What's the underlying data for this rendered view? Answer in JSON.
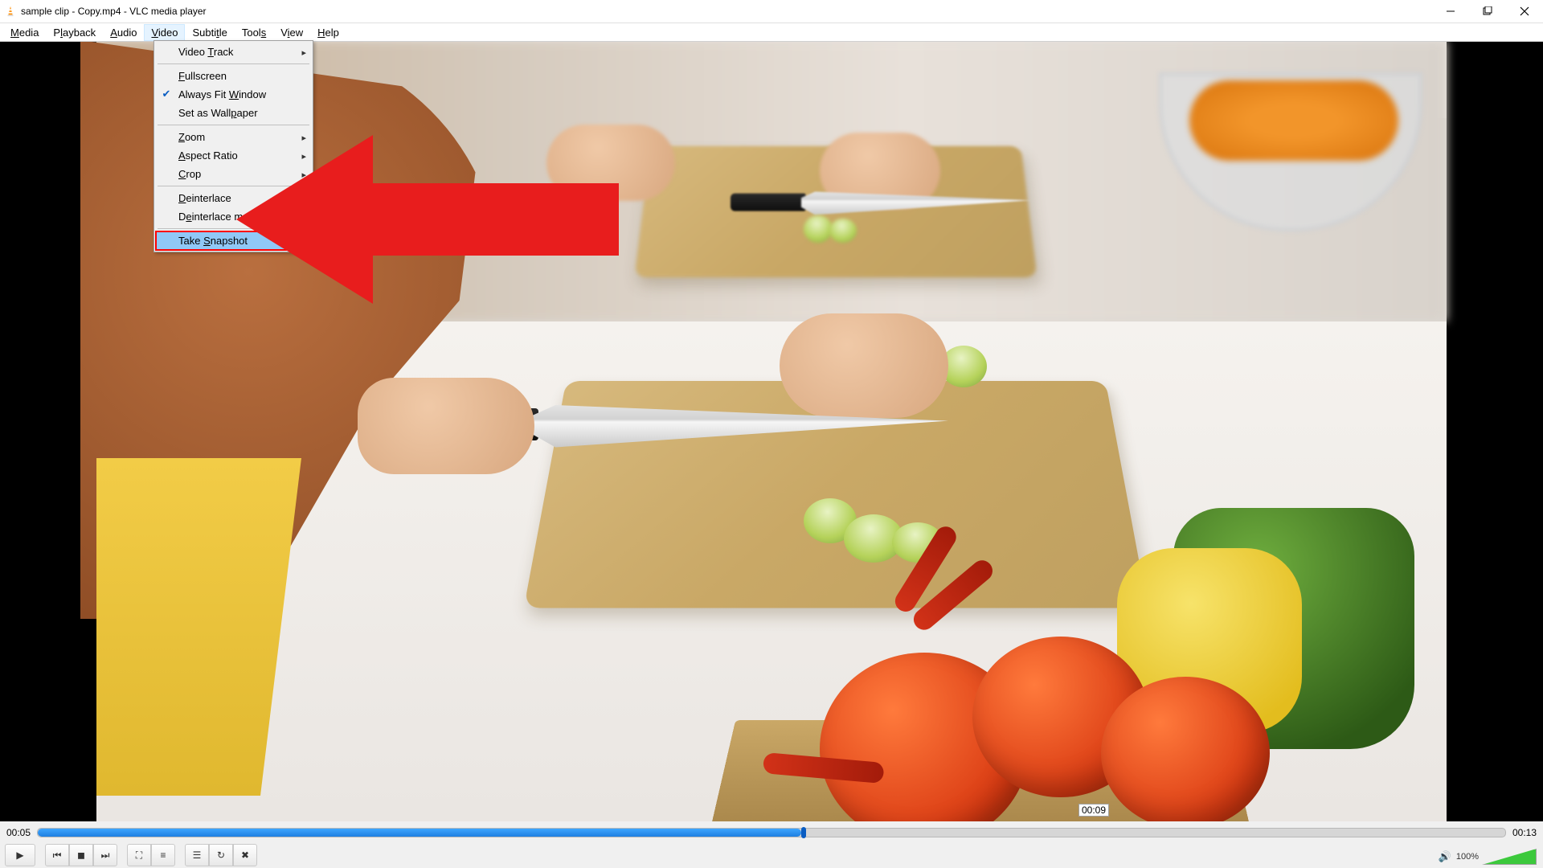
{
  "title": "sample clip - Copy.mp4 - VLC media player",
  "menus": {
    "media": "Media",
    "playback": "Playback",
    "audio": "Audio",
    "video": "Video",
    "subtitle": "Subtitle",
    "tools": "Tools",
    "view": "View",
    "help": "Help"
  },
  "video_menu": {
    "video_track": "Video Track",
    "fullscreen": "Fullscreen",
    "always_fit": "Always Fit Window",
    "set_wallpaper": "Set as Wallpaper",
    "zoom": "Zoom",
    "aspect_ratio": "Aspect Ratio",
    "crop": "Crop",
    "deinterlace": "Deinterlace",
    "deinterlace_mode": "Deinterlace mode",
    "take_snapshot": "Take Snapshot"
  },
  "seek": {
    "elapsed": "00:05",
    "total": "00:13",
    "tooltip": "00:09"
  },
  "volume": {
    "label": "100%"
  },
  "colors": {
    "highlight_blue": "#90c8f6",
    "annotation_red": "#e81d1d"
  }
}
